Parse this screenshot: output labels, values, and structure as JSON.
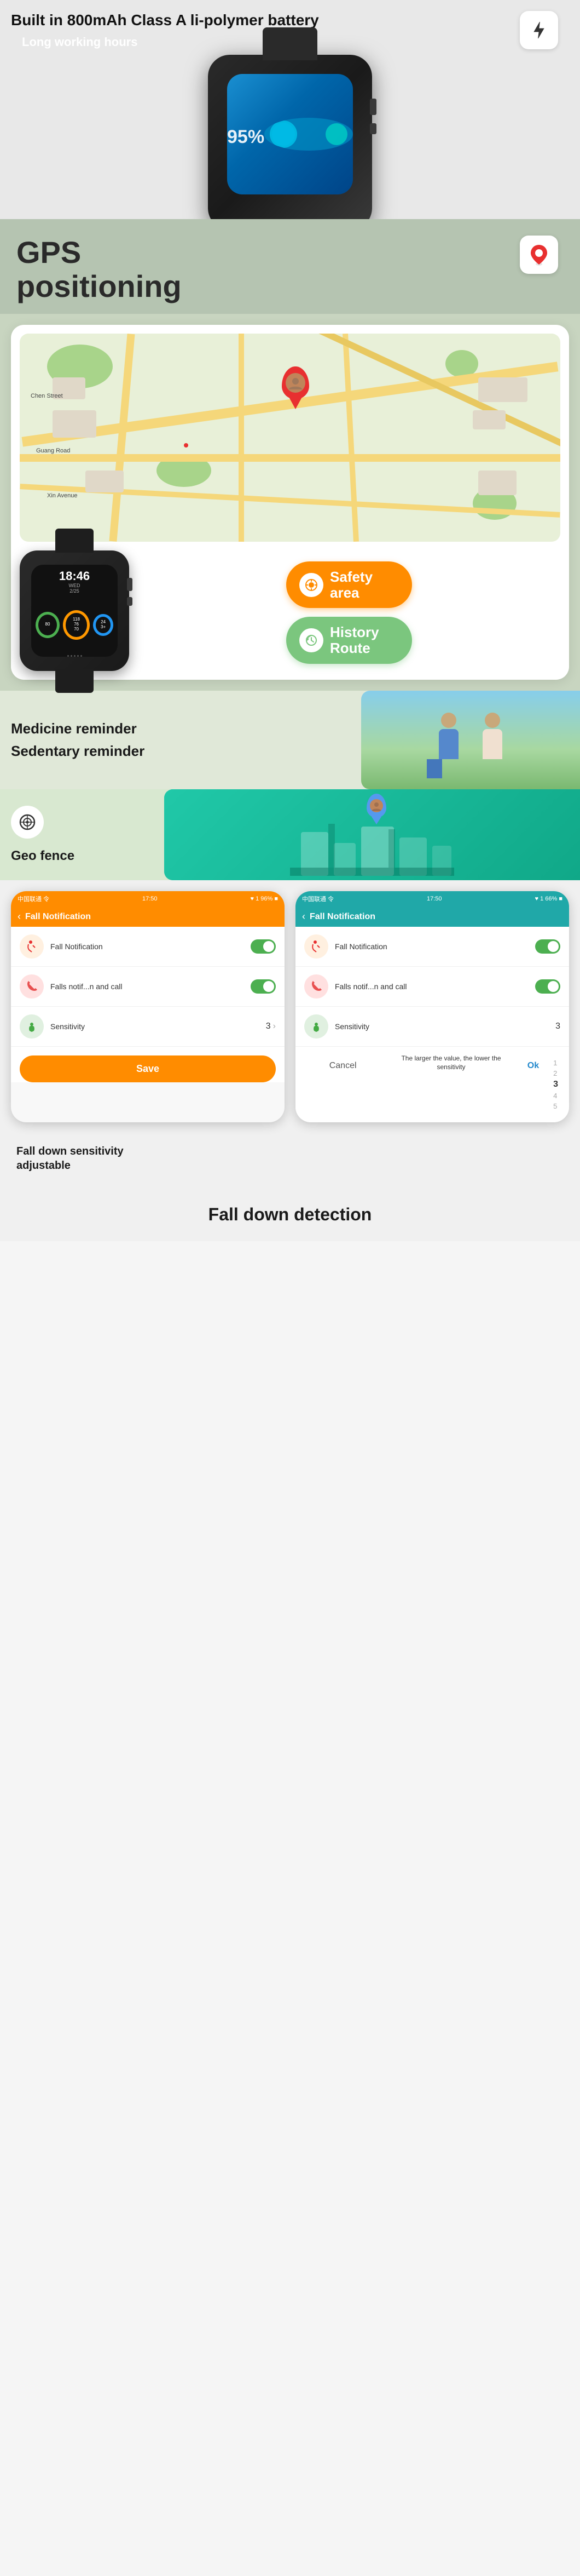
{
  "battery": {
    "title": "Built in 800mAh Class A li-polymer battery",
    "subtitle": "Long working hours",
    "percent": "95%",
    "icon": "⚡"
  },
  "gps": {
    "title": "GPS\npositioning",
    "icon": "📍"
  },
  "map": {
    "safety_area_label": "Safety\narea",
    "history_route_label": "History\nRoute"
  },
  "watch_time": "18:46",
  "watch_date": "WED\n2/25",
  "watch_dials": [
    {
      "value": "80",
      "color": "#4CAF50"
    },
    {
      "value": "118\n76\n70",
      "color": "#FF9800"
    },
    {
      "value": "24\n3+",
      "color": "#2196F3"
    }
  ],
  "reminder": {
    "items": [
      "Medicine reminder",
      "Sedentary reminder"
    ]
  },
  "geo_fence": {
    "label": "Geo fence"
  },
  "fall_notification": {
    "phone1": {
      "status_time": "17:50",
      "status_left": "中国联通 令",
      "status_right": "♥ 1 96% ■",
      "header_title": "Fall Notification",
      "rows": [
        {
          "icon": "🏃",
          "label": "Fall Notification",
          "control": "toggle"
        },
        {
          "icon": "📞",
          "label": "Falls notif...n and call",
          "control": "toggle"
        },
        {
          "icon": "🚴",
          "label": "Sensitivity",
          "control": "value",
          "value": "3"
        }
      ],
      "save_label": "Save"
    },
    "phone2": {
      "status_time": "17:50",
      "status_left": "中国联通 令",
      "status_right": "♥ 1 66% ■",
      "header_title": "Fall Notification",
      "rows": [
        {
          "icon": "🏃",
          "label": "Fall Notification",
          "control": "toggle"
        },
        {
          "icon": "📞",
          "label": "Falls notif...n and call",
          "control": "toggle"
        },
        {
          "icon": "🚴",
          "label": "Sensitivity",
          "control": "value",
          "value": "3"
        }
      ],
      "cancel_label": "Cancel",
      "ok_label": "Ok",
      "hint": "The larger the value, the lower the sensitivity",
      "numbers": [
        "1",
        "2",
        "3",
        "4",
        "5"
      ]
    }
  },
  "fall_desc": {
    "title": "Fall down sensitivity\nadjustable",
    "bottom_title": "Fall down detection"
  }
}
